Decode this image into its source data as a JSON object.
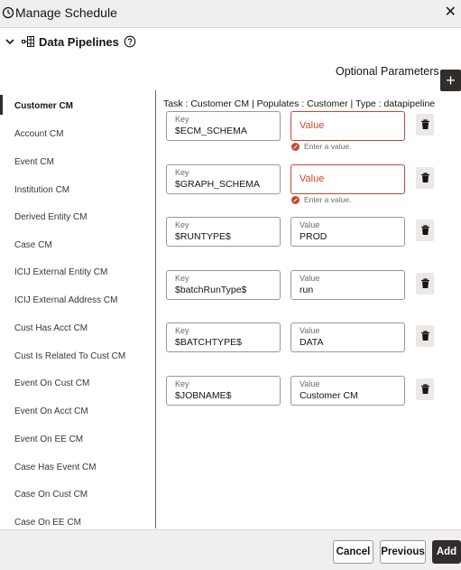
{
  "dialog": {
    "title": "Manage Schedule"
  },
  "section": {
    "title": "Data Pipelines"
  },
  "optional_params": {
    "label": "Optional Parameters",
    "add_symbol": "+"
  },
  "sidebar": {
    "items": [
      {
        "label": "Customer CM",
        "active": true
      },
      {
        "label": "Account CM"
      },
      {
        "label": "Event CM"
      },
      {
        "label": "Institution CM"
      },
      {
        "label": "Derived Entity CM"
      },
      {
        "label": "Case CM"
      },
      {
        "label": "ICIJ External Entity CM"
      },
      {
        "label": "ICIJ External Address CM"
      },
      {
        "label": "Cust Has Acct CM"
      },
      {
        "label": "Cust Is Related To Cust CM"
      },
      {
        "label": "Event On Cust CM"
      },
      {
        "label": "Event On Acct CM"
      },
      {
        "label": "Event On EE CM"
      },
      {
        "label": "Case Has Event CM"
      },
      {
        "label": "Case On Cust CM"
      },
      {
        "label": "Case On EE CM"
      }
    ]
  },
  "task_line": "Task : Customer CM | Populates : Customer | Type : datapipeline",
  "params": [
    {
      "key_label": "Key",
      "key": "$ECM_SCHEMA",
      "value_label": "",
      "value": "",
      "placeholder": "Value",
      "error": "Enter a value."
    },
    {
      "key_label": "Key",
      "key": "$GRAPH_SCHEMA",
      "value_label": "",
      "value": "",
      "placeholder": "Value",
      "error": "Enter a value."
    },
    {
      "key_label": "Key",
      "key": "$RUNTYPE$",
      "value_label": "Value",
      "value": "PROD"
    },
    {
      "key_label": "Key",
      "key": "$batchRunType$",
      "value_label": "Value",
      "value": "run"
    },
    {
      "key_label": "Key",
      "key": "$BATCHTYPE$",
      "value_label": "Value",
      "value": "DATA"
    },
    {
      "key_label": "Key",
      "key": "$JOBNAME$",
      "value_label": "Value",
      "value": "Customer CM"
    }
  ],
  "footer": {
    "cancel": "Cancel",
    "previous": "Previous",
    "add": "Add"
  },
  "colors": {
    "error": "#c74634",
    "primary": "#312d2a",
    "chrome": "#f1efed"
  },
  "icons": {
    "title": "schedule-clock-icon",
    "close": "close-icon",
    "chevron": "chevron-down-icon",
    "pipeline": "pipeline-icon",
    "help": "help-icon",
    "add": "plus-icon",
    "delete": "trash-icon",
    "error": "error-icon"
  }
}
